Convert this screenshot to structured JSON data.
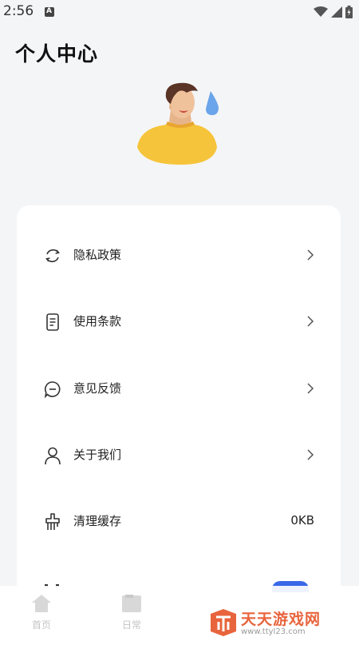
{
  "status_bar": {
    "time": "2:56",
    "notif_letter": "A"
  },
  "header": {
    "title": "个人中心"
  },
  "menu": [
    {
      "label": "隐私政策",
      "icon": "refresh-icon",
      "arrow": true
    },
    {
      "label": "使用条款",
      "icon": "document-icon",
      "arrow": true
    },
    {
      "label": "意见反馈",
      "icon": "chat-bubble-icon",
      "arrow": true
    },
    {
      "label": "关于我们",
      "icon": "person-icon",
      "arrow": true
    },
    {
      "label": "清理缓存",
      "icon": "brush-icon",
      "value": "0KB"
    }
  ],
  "tabbar": {
    "tabs": [
      {
        "label": "首页",
        "icon": "home-icon"
      },
      {
        "label": "日常",
        "icon": "folder-icon"
      }
    ]
  },
  "watermark": {
    "text": "天天游戏网",
    "url": "www.ttyl23.com"
  },
  "colors": {
    "background": "#f4f5f7",
    "accent": "#3a68e8",
    "watermark": "#e8643c"
  }
}
